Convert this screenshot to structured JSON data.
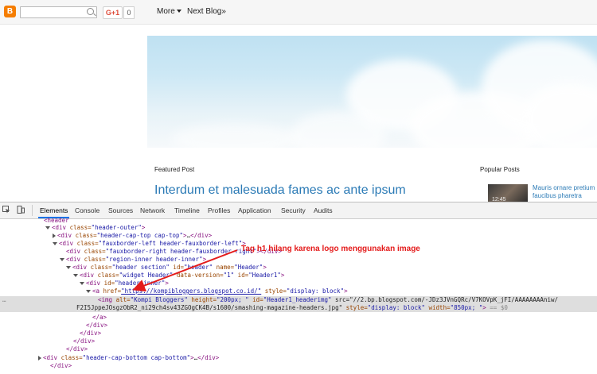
{
  "navbar": {
    "gplus_label": "G+1",
    "gplus_count": "0",
    "more_label": "More",
    "next_blog_label": "Next Blog»"
  },
  "blog": {
    "featured_heading": "Featured Post",
    "post_title": "Interdum et malesuada fames ac ante ipsum",
    "popular_heading": "Popular Posts",
    "popular_time": "12:45",
    "popular_title": "Mauris ornare pretium faucibus pharetra"
  },
  "devtools": {
    "tabs": [
      "Elements",
      "Console",
      "Sources",
      "Network",
      "Timeline",
      "Profiles",
      "Application",
      "Security",
      "Audits"
    ],
    "lines": [
      {
        "t": "<header",
        "partial": true
      },
      {
        "t": "<div class=\"header-outer\">"
      },
      {
        "t": "<div class=\"header-cap-top cap-top\">…</div>"
      },
      {
        "t": "<div class=\"fauxborder-left header-fauxborder-left\">"
      },
      {
        "t": "<div class=\"fauxborder-right header-fauxborder-right\"></div>"
      },
      {
        "t": "<div class=\"region-inner header-inner\">"
      },
      {
        "t": "<div class=\"header section\" id=\"header\" name=\"Header\">"
      },
      {
        "t": "<div class=\"widget Header\" data-version=\"1\" id=\"Header1\">"
      },
      {
        "t": "<div id=\"header-inner\">"
      },
      {
        "t": "<a href=\"https://kompibloggers.blogspot.co.id/\" style=\"display: block\">"
      },
      {
        "t1": "<img alt=\"Kompi Bloggers\" height=\"200px; \" id=\"Header1_headerimg\" src=\"//2.bp.blogspot.com/-JDz3JVnGQRc/V7KOVpK_jFI/AAAAAAAAniw/",
        "t2": "F2I5JppeJOsgzObR2_ni29ch4sv43ZGOgCK4B/s1600/smashing-magazine-headers.jpg\" style=\"display: block\" width=\"850px; \"> == $0"
      },
      {
        "t": "</a>"
      },
      {
        "t": "</div>"
      },
      {
        "t": "</div>"
      },
      {
        "t": "</div>"
      },
      {
        "t": "</div>"
      },
      {
        "t": "<div class=\"header-cap-bottom cap-bottom\">…</div>"
      },
      {
        "t": "</div>"
      }
    ]
  },
  "annotation": {
    "text": "Tag h1 hilang karena logo menggunakan image",
    "color": "#e41b1b"
  }
}
